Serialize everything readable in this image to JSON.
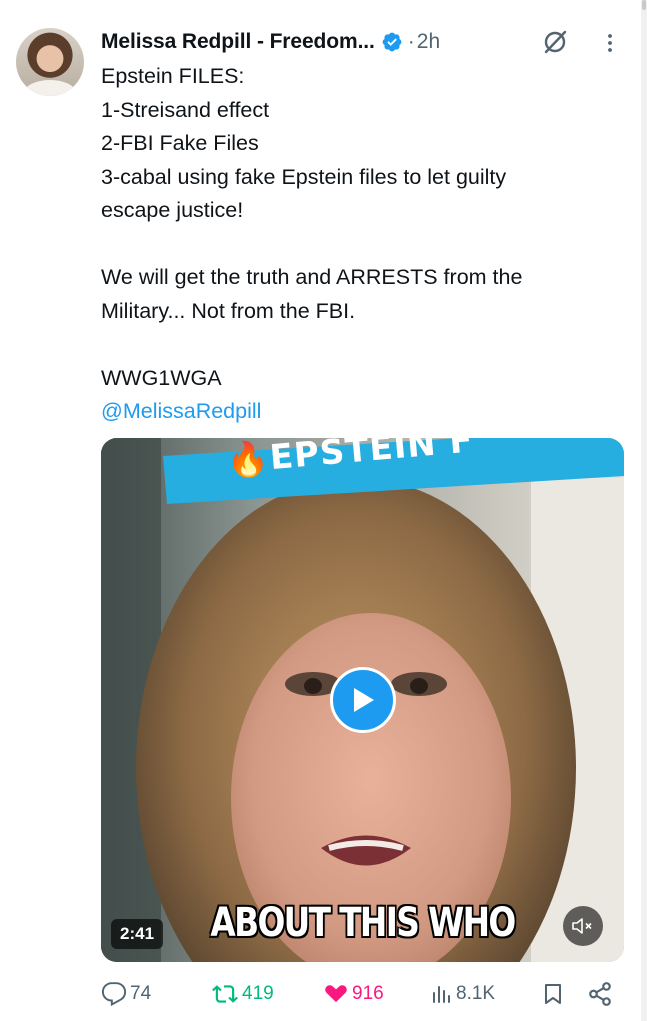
{
  "author": {
    "display_name": "Melissa Redpill - Freedom...",
    "timestamp": "2h",
    "separator": "·"
  },
  "tweet": {
    "lines": [
      "Epstein FILES:",
      "1-Streisand effect",
      "2-FBI Fake Files",
      "3-cabal using fake Epstein files to let guilty",
      "escape justice!",
      "",
      "We will get the truth and ARRESTS from the",
      "Military... Not from the FBI.",
      "",
      "WWG1WGA"
    ],
    "mention": "@MelissaRedpill"
  },
  "media": {
    "duration": "2:41",
    "banner_text": "EPSTEIN F",
    "banner_emoji": "🔥",
    "caption": "ABOUT THIS WHO"
  },
  "engagement": {
    "replies": "74",
    "reposts": "419",
    "likes": "916",
    "views": "8.1K"
  },
  "colors": {
    "accent": "#1d9bf0",
    "repost": "#00ba7c",
    "like": "#f91880",
    "secondary": "#536471",
    "banner": "#27aee0"
  },
  "icons": {
    "verified": "verified-badge-icon",
    "grok": "grok-icon",
    "more": "more-options-icon",
    "play": "play-icon",
    "mute": "muted-speaker-icon",
    "reply": "reply-icon",
    "repost": "repost-icon",
    "like": "heart-icon",
    "views": "views-icon",
    "bookmark": "bookmark-icon",
    "share": "share-icon"
  }
}
